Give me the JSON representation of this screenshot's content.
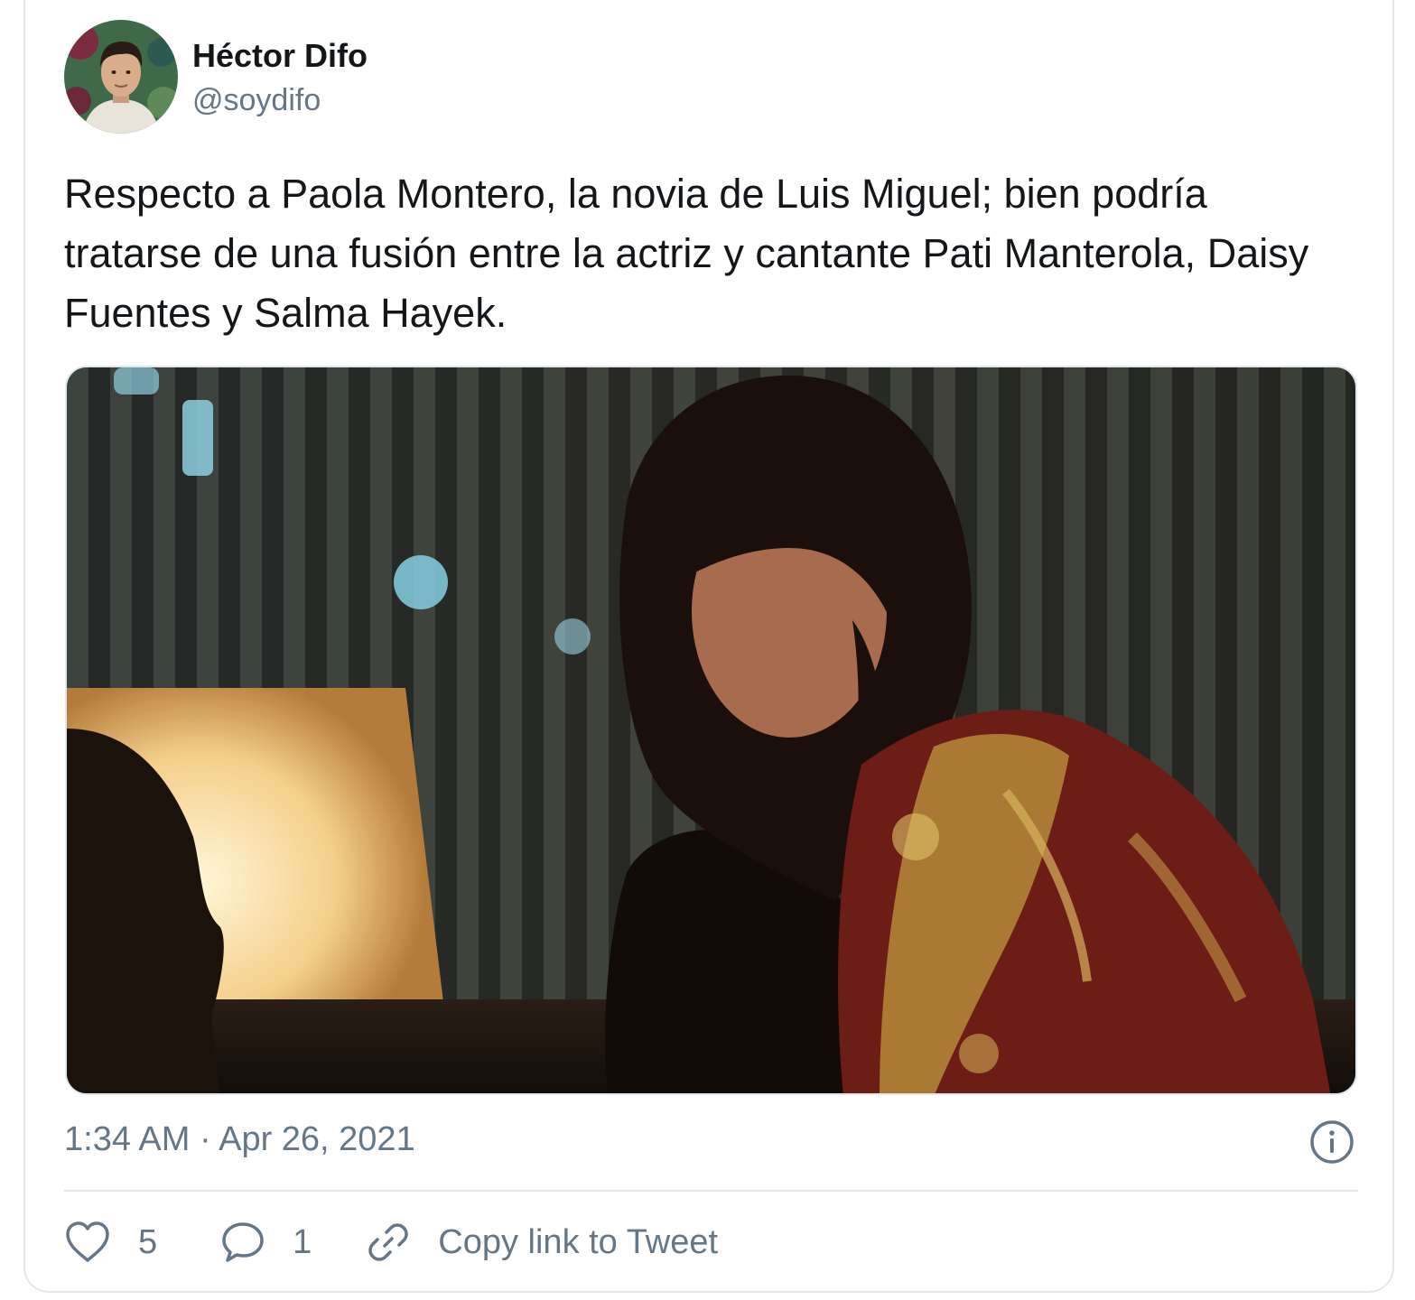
{
  "tweet": {
    "author_name": "Héctor Difo",
    "author_handle": "@soydifo",
    "text": "Respecto a Paola Montero, la novia de Luis Miguel; bien podría tratarse de una fusión entre la actriz y cantante Pati Manterola, Daisy Fuentes y Salma Hayek.",
    "timestamp": "1:34 AM · Apr 26, 2021",
    "likes": "5",
    "replies": "1",
    "copy_link_label": "Copy link to Tweet"
  },
  "icons": {
    "like": "heart-icon",
    "reply": "speech-bubble-icon",
    "copy_link": "link-icon",
    "info": "info-icon"
  },
  "colors": {
    "text_primary": "#14171a",
    "text_secondary": "#657786",
    "border": "#e1e8ed"
  }
}
